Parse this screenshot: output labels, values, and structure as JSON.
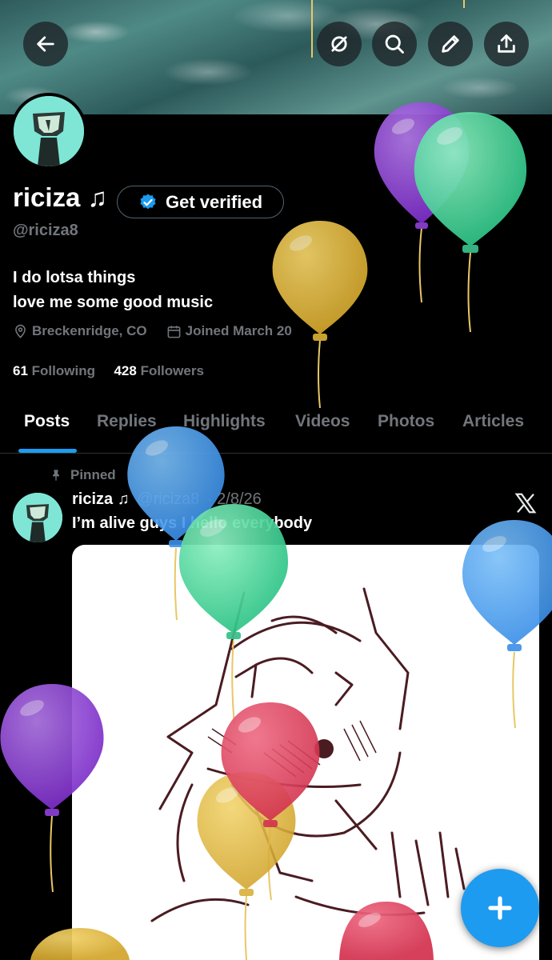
{
  "profile": {
    "display_name": "riciza ♫",
    "verified_label": "Get verified",
    "handle": "@riciza8",
    "bio_line1": "I do lotsa things",
    "bio_line2": "love me some good music",
    "location": "Breckenridge, CO",
    "joined": "Joined March 20",
    "following_count": "61",
    "following_label": "Following",
    "followers_count": "428",
    "followers_label": "Followers"
  },
  "tabs": [
    {
      "label": "Posts"
    },
    {
      "label": "Replies"
    },
    {
      "label": "Highlights"
    },
    {
      "label": "Videos"
    },
    {
      "label": "Photos"
    },
    {
      "label": "Articles"
    }
  ],
  "post": {
    "pinned_label": "Pinned",
    "author_name": "riciza ♫",
    "author_handle": "@riciza8",
    "date": "· 2/8/26",
    "text": "I’m alive guys I hello everybody"
  },
  "colors": {
    "accent": "#1d9bf0",
    "background": "#000000",
    "muted_text": "#71767b"
  },
  "icons": [
    "back-arrow-icon",
    "grok-icon",
    "search-icon",
    "edit-icon",
    "share-icon",
    "location-icon",
    "calendar-icon",
    "pin-icon",
    "x-logo-icon",
    "plus-icon",
    "verified-badge-icon"
  ]
}
